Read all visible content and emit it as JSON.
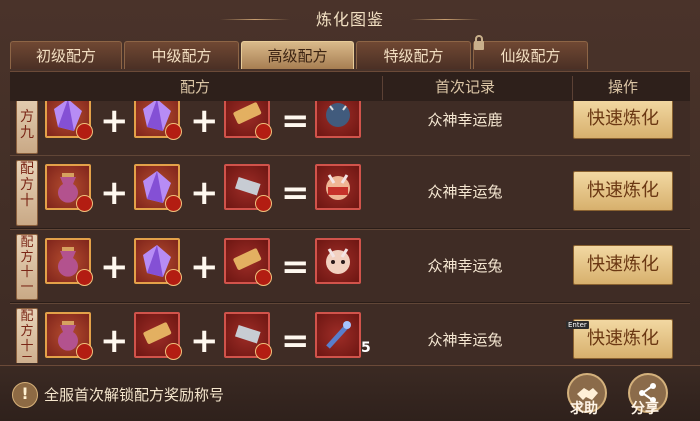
{
  "title": "炼化图鉴",
  "tabs": [
    {
      "label": "初级配方",
      "active": false
    },
    {
      "label": "中级配方",
      "active": false
    },
    {
      "label": "高级配方",
      "active": true
    },
    {
      "label": "特级配方",
      "active": false
    },
    {
      "label": "仙级配方",
      "active": false,
      "locked": true
    }
  ],
  "header": {
    "recipe": "配方",
    "first_record": "首次记录",
    "action": "操作"
  },
  "rows": [
    {
      "label": "方九",
      "record": "众神幸运鹿",
      "button": "快速炼化"
    },
    {
      "label": "配方十",
      "record": "众神幸运兔",
      "button": "快速炼化"
    },
    {
      "label": "配方十一",
      "record": "众神幸运兔",
      "button": "快速炼化"
    },
    {
      "label": "配方十二",
      "record": "众神幸运兔",
      "button": "快速炼化",
      "result_count": "5"
    }
  ],
  "footer": {
    "notice": "全服首次解锁配方奖励称号",
    "help": "求助",
    "share": "分享"
  },
  "tooltip": "Enter",
  "colors": {
    "button": "#e8c98d",
    "tab_active": "#c8a06f",
    "frame_gold": "#e3a149",
    "frame_red": "#d1534b"
  }
}
